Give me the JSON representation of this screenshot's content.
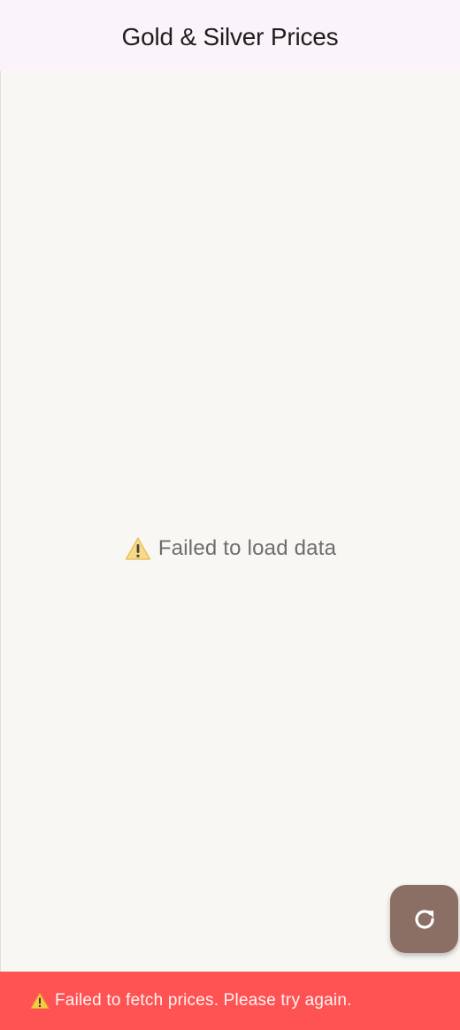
{
  "app_bar": {
    "title": "Gold & Silver Prices"
  },
  "content": {
    "error_icon": "warning-icon",
    "error_message": "Failed to load data"
  },
  "fab": {
    "icon": "refresh-icon"
  },
  "snackbar": {
    "icon": "warning-icon",
    "message": "Failed to fetch prices. Please try again."
  },
  "colors": {
    "app_bar_bg": "#fbf3fa",
    "content_bg": "#f8f7f4",
    "fab_bg": "#8c6f64",
    "snackbar_bg": "#ff5353",
    "warning_yellow": "#f7c948"
  }
}
